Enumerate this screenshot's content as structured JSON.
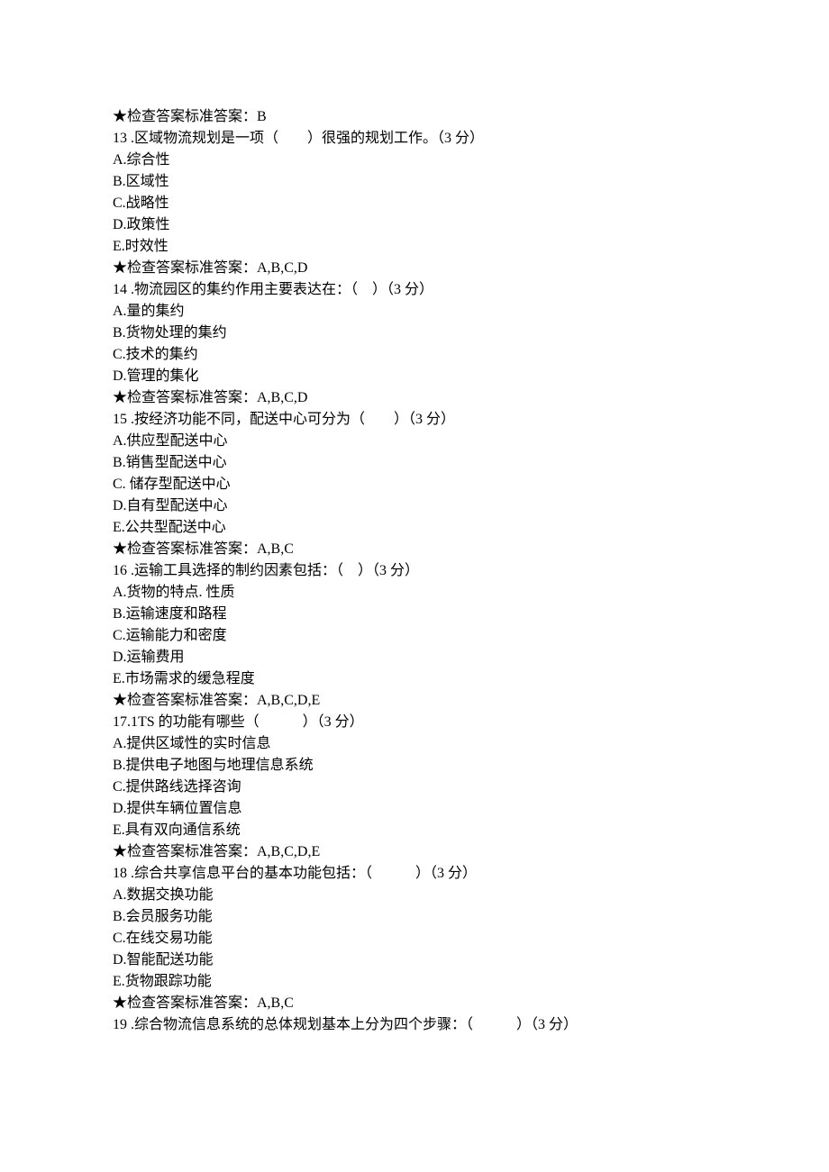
{
  "lines": [
    "★检查答案标准答案：B",
    "13 .区域物流规划是一项（　　）很强的规划工作。（3 分）",
    "A.综合性",
    "B.区域性",
    "C.战略性",
    "D.政策性",
    "E.时效性",
    "★检查答案标准答案：A,B,C,D",
    "14 .物流园区的集约作用主要表达在：（　）（3 分）",
    "A.量的集约",
    "B.货物处理的集约",
    "C.技术的集约",
    "D.管理的集化",
    "★检查答案标准答案：A,B,C,D",
    "15 .按经济功能不同，配送中心可分为（　　）（3 分）",
    "A.供应型配送中心",
    "B.销售型配送中心",
    "C. 储存型配送中心",
    "D.自有型配送中心",
    "E.公共型配送中心",
    "★检查答案标准答案：A,B,C",
    "16 .运输工具选择的制约因素包括：（　）（3 分）",
    "A.货物的特点. 性质",
    "B.运输速度和路程",
    "C.运输能力和密度",
    "D.运输费用",
    "E.市场需求的缓急程度",
    "★检查答案标准答案：A,B,C,D,E",
    "17.1TS 的功能有哪些（　　　）（3 分）",
    "A.提供区域性的实时信息",
    "B.提供电子地图与地理信息系统",
    "C.提供路线选择咨询",
    "D.提供车辆位置信息",
    "E.具有双向通信系统",
    "★检查答案标准答案：A,B,C,D,E",
    "18 .综合共享信息平台的基本功能包括：（　　　）（3 分）",
    "A.数据交换功能",
    "B.会员服务功能",
    "C.在线交易功能",
    "D.智能配送功能",
    "E.货物跟踪功能",
    "★检查答案标准答案：A,B,C",
    "19 .综合物流信息系统的总体规划基本上分为四个步骤：（　　　）（3 分）"
  ]
}
